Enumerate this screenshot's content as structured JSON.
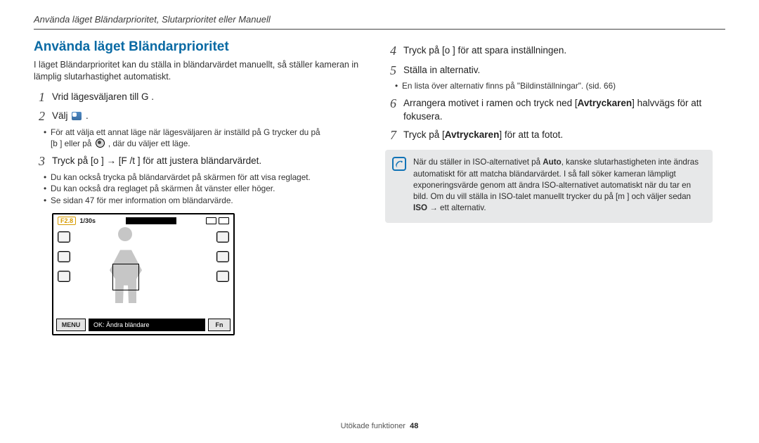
{
  "header": {
    "running": "Använda läget Bländarprioritet, Slutarprioritet eller Manuell"
  },
  "left": {
    "title": "Använda läget Bländarprioritet",
    "intro": "I läget Bländarprioritet kan du ställa in bländarvärdet manuellt, så ställer kameran in lämplig slutarhastighet automatiskt.",
    "step1": "Vrid lägesväljaren till G           .",
    "step2": "Välj ",
    "step2_end": " .",
    "step2_sub1a": "För att välja ett annat läge när lägesväljaren är inställd på G           trycker du på ",
    "step2_sub1b": "[b     ] eller på ",
    "step2_sub1c": ", där du väljer ett läge.",
    "step3": "Tryck på [o      ] → [F  /t    ] för att justera bländarvärdet.",
    "step3_sub1": "Du kan också trycka på bländarvärdet på skärmen för att visa reglaget.",
    "step3_sub2": "Du kan också dra reglaget på skärmen åt vänster eller höger.",
    "step3_sub3": "Se sidan 47 för mer information om bländarvärde.",
    "shot": {
      "f": "F2.8",
      "shutter": "1/30s",
      "ok": "OK: Ändra bländare",
      "menu": "MENU",
      "fn": "Fn"
    }
  },
  "right": {
    "step4": "Tryck på [o      ] för att spara inställningen.",
    "step5": "Ställa in alternativ.",
    "step5_sub1": "En lista över alternativ finns på \"Bildinställningar\". (sid. 66)",
    "step6a": "Arrangera motivet i ramen och tryck ned [",
    "step6b": "Avtryckaren",
    "step6c": "] halvvägs för att fokusera.",
    "step7a": "Tryck på [",
    "step7b": "Avtryckaren",
    "step7c": "] för att ta fotot.",
    "note_sym": "i",
    "note1": "När du ställer in ISO-alternativet på ",
    "note_auto": "Auto",
    "note2": ", kanske slutarhastigheten inte ändras automatiskt för att matcha bländarvärdet. I så fall söker kameran lämpligt exponeringsvärde genom att ändra ISO-alternativet automatiskt när du tar en bild. Om du vill ställa in ISO-talet manuellt trycker du på [m         ] och väljer sedan ",
    "note_iso": "ISO",
    "note3": " → ett alternativ."
  },
  "footer": {
    "label": "Utökade funktioner",
    "page": "48"
  }
}
